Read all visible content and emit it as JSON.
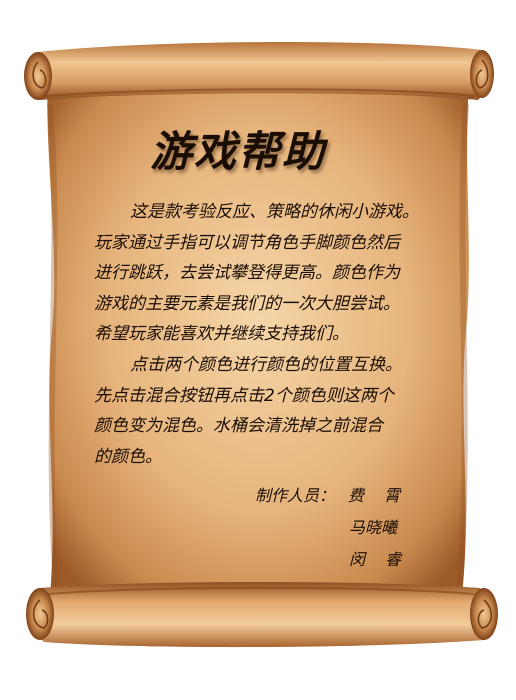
{
  "help_screen": {
    "title": "游戏帮助",
    "paragraph_1": [
      "这是款考验反应、策略的休闲小游戏。",
      "玩家通过手指可以调节角色手脚颜色然后",
      "进行跳跃，去尝试攀登得更高。颜色作为",
      "游戏的主要元素是我们的一次大胆尝试。",
      "希望玩家能喜欢并继续支持我们。"
    ],
    "paragraph_2": [
      "点击两个颜色进行颜色的位置互换。",
      "先点击混合按钮再点击2个颜色则这两个",
      "颜色变为混色。水桶会清洗掉之前混合",
      "的颜色。"
    ],
    "credits": {
      "label": "制作人员：",
      "names": [
        "费　霄",
        "马晓曦",
        "闵　睿"
      ]
    }
  },
  "colors": {
    "parchment_light": "#f0c692",
    "parchment_dark": "#b06a32",
    "text": "#1b0e05"
  }
}
